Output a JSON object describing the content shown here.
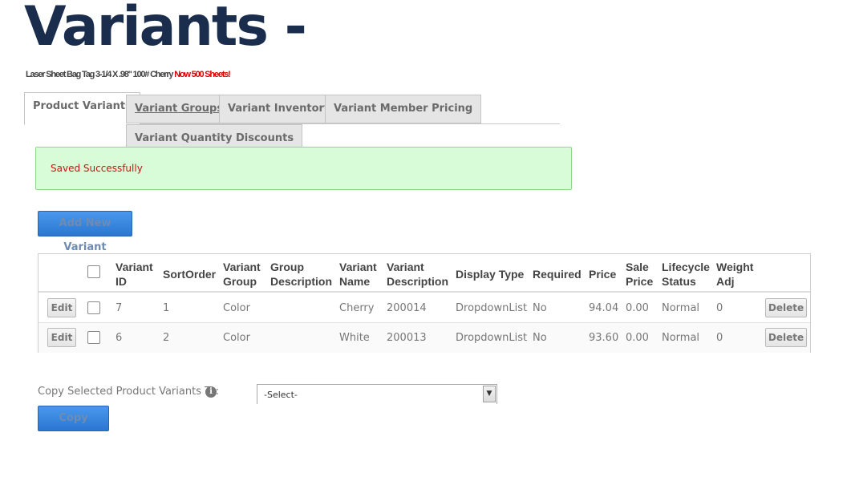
{
  "page": {
    "title": "Variants -",
    "product_name": "Laser Sheet Bag Tag 3-1/4 X .98\" 100# Cherry ",
    "product_highlight": "Now 500 Sheets!"
  },
  "tabs": [
    {
      "label": "Product Variants",
      "active": true
    },
    {
      "label": "Variant Groups",
      "active": false
    },
    {
      "label": "Variant Inventory",
      "active": false
    },
    {
      "label": "Variant Member Pricing",
      "active": false
    },
    {
      "label": "Variant Quantity Discounts",
      "active": false
    }
  ],
  "message": {
    "text": "Saved Successfully"
  },
  "actions": {
    "add_label": "Add New Variant",
    "copy_label": "Copy"
  },
  "grid": {
    "headers": {
      "variant_id": [
        "Variant",
        "ID"
      ],
      "sort_order": "SortOrder",
      "variant_group": [
        "Variant",
        "Group"
      ],
      "group_description": [
        "Group",
        "Description"
      ],
      "variant_name": [
        "Variant",
        "Name"
      ],
      "variant_description": [
        "Variant",
        "Description"
      ],
      "display_type": "Display Type",
      "required": "Required",
      "price": "Price",
      "sale_price": [
        "Sale",
        "Price"
      ],
      "lifecycle_status": [
        "Lifecycle",
        "Status"
      ],
      "weight_adj": [
        "Weight",
        "Adj"
      ]
    },
    "edit_label": "Edit",
    "delete_label": "Delete",
    "rows": [
      {
        "variant_id": "7",
        "sort_order": "1",
        "variant_group": "Color",
        "group_description": "",
        "variant_name": "Cherry",
        "variant_description": "200014",
        "display_type": "DropdownList",
        "required": "No",
        "price": "94.04",
        "sale_price": "0.00",
        "lifecycle_status": "Normal",
        "weight_adj": "0"
      },
      {
        "variant_id": "6",
        "sort_order": "2",
        "variant_group": "Color",
        "group_description": "",
        "variant_name": "White",
        "variant_description": "200013",
        "display_type": "DropdownList",
        "required": "No",
        "price": "93.60",
        "sale_price": "0.00",
        "lifecycle_status": "Normal",
        "weight_adj": "0"
      }
    ]
  },
  "copy_section": {
    "label": "Copy Selected Product Variants To:",
    "info_icon": "info-icon",
    "select_value": "-Select-"
  },
  "colors": {
    "title": "#1a2d4d",
    "highlight": "#e00000",
    "success_bg": "#d8fcd8",
    "success_text": "#cc1111",
    "button_blue": "#2a76d2"
  }
}
